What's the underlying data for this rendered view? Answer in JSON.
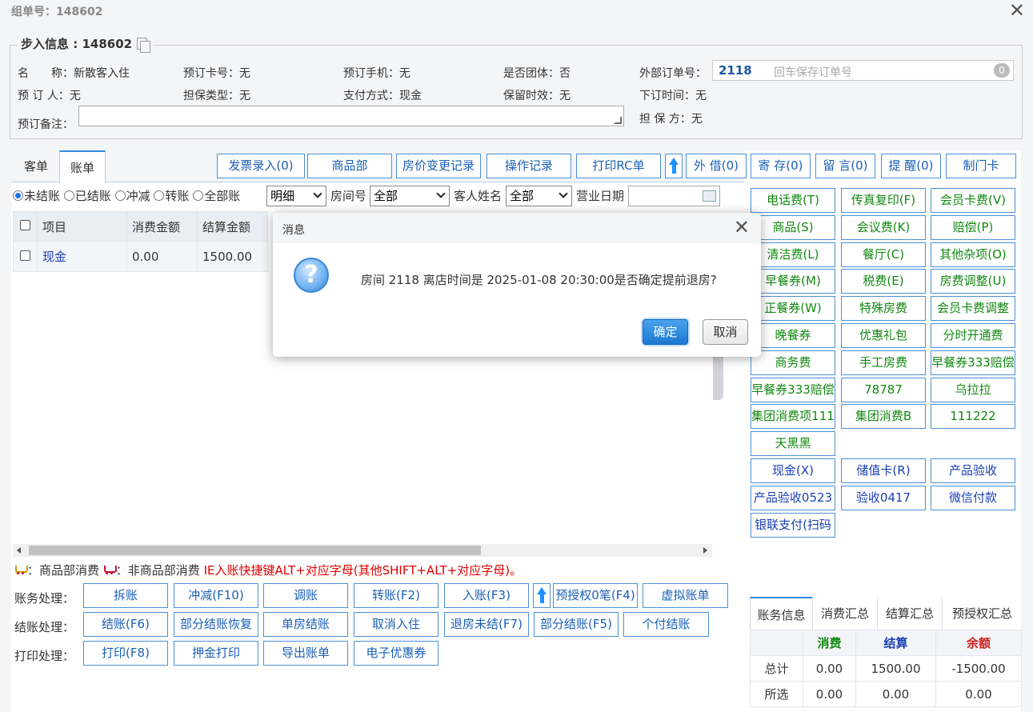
{
  "window": {
    "title": "组单号：148602"
  },
  "group": {
    "legend": "步入信息 : 148602"
  },
  "info": {
    "name_label": "名　　称：",
    "name_value": "新散客入住",
    "card_label": "预订卡号：",
    "card_value": "无",
    "phone_label": "预订手机：",
    "phone_value": "无",
    "team_label": "是否团体：",
    "team_value": "否",
    "ext_label": "外部订单号：",
    "ext_value": "2118",
    "ext_placeholder": "回车保存订单号",
    "ext_badge": "0",
    "booker_label": "预 订 人：",
    "booker_value": "无",
    "guarantee_label": "担保类型：",
    "guarantee_value": "无",
    "pay_label": "支付方式：",
    "pay_value": "现金",
    "keep_label": "保留时效：",
    "keep_value": "无",
    "order_time_label": "下订时间：",
    "order_time_value": "无",
    "remark_label": "预订备注：",
    "guarantor_label": "担 保 方：",
    "guarantor_value": "无"
  },
  "tabs": [
    "客单",
    "账单"
  ],
  "toolbar": [
    "发票录入(0)",
    "商品部",
    "房价变更记录",
    "操作记录",
    "打印RC单",
    "外 借(0)",
    "寄 存(0)",
    "留 言(0)",
    "提 醒(0)",
    "制门卡"
  ],
  "filters": {
    "radios": [
      "未结账",
      "已结账",
      "冲减",
      "转账",
      "全部账"
    ],
    "detail": "明细",
    "room_label": "房间号",
    "room_value": "全部",
    "guest_label": "客人姓名",
    "guest_value": "全部",
    "date_label": "营业日期"
  },
  "grid": {
    "headers": [
      "项目",
      "消费金额",
      "结算金额"
    ],
    "rows": [
      {
        "item": "现金",
        "consume": "0.00",
        "settle": "1500.00"
      }
    ]
  },
  "right_buttons_green": [
    [
      "电话费(T)",
      "传真复印(F)",
      "会员卡费(V)"
    ],
    [
      "商品(S)",
      "会议费(K)",
      "赔偿(P)"
    ],
    [
      "清洁费(L)",
      "餐厅(C)",
      "其他杂项(O)"
    ],
    [
      "早餐券(M)",
      "税费(E)",
      "房费调整(U)"
    ],
    [
      "正餐券(W)",
      "特殊房费",
      "会员卡费调整"
    ],
    [
      "晚餐券",
      "优惠礼包",
      "分时开通费"
    ],
    [
      "商务费",
      "手工房费",
      "早餐券333赔偿"
    ],
    [
      "早餐券333赔偿",
      "78787",
      "乌拉拉"
    ],
    [
      "集团消费项111",
      "集团消费B",
      "111222"
    ],
    [
      "天黑黑"
    ]
  ],
  "right_buttons_blue": [
    [
      "现金(X)",
      "储值卡(R)",
      "产品验收"
    ],
    [
      "产品验收0523",
      "验收0417",
      "微信付款"
    ],
    [
      "银联支付(扫码"
    ]
  ],
  "legend_line": {
    "a": "：商品部消费",
    "b": "：非商品部消费 ",
    "hint": "IE入账快捷键ALT+对应字母(其他SHIFT+ALT+对应字母)。"
  },
  "ops": {
    "acc_label": "账务处理：",
    "acc": [
      "拆账",
      "冲减(F10)",
      "调账",
      "转账(F2)",
      "入账(F3)",
      "预授权0笔(F4)",
      "虚拟账单"
    ],
    "settle_label": "结账处理：",
    "settle": [
      "结账(F6)",
      "部分结账恢复",
      "单房结账",
      "取消入住",
      "退房未结(F7)",
      "部分结账(F5)",
      "个付结账"
    ],
    "print_label": "打印处理：",
    "print": [
      "打印(F8)",
      "押金打印",
      "导出账单",
      "电子优惠券"
    ]
  },
  "summary": {
    "tabs": [
      "账务信息",
      "消费汇总",
      "结算汇总",
      "预授权汇总"
    ],
    "headers": [
      "",
      "消费",
      "结算",
      "余额"
    ],
    "rows": [
      [
        "总计",
        "0.00",
        "1500.00",
        "-1500.00"
      ],
      [
        "所选",
        "0.00",
        "0.00",
        "0.00"
      ]
    ],
    "colors": {
      "consume": "#118811",
      "settle": "#1a3fb4",
      "balance": "#d02020"
    }
  },
  "dialog": {
    "title": "消息",
    "message": "房间 2118 离店时间是 2025-01-08 20:30:00是否确定提前退房?",
    "ok": "确定",
    "cancel": "取消"
  }
}
